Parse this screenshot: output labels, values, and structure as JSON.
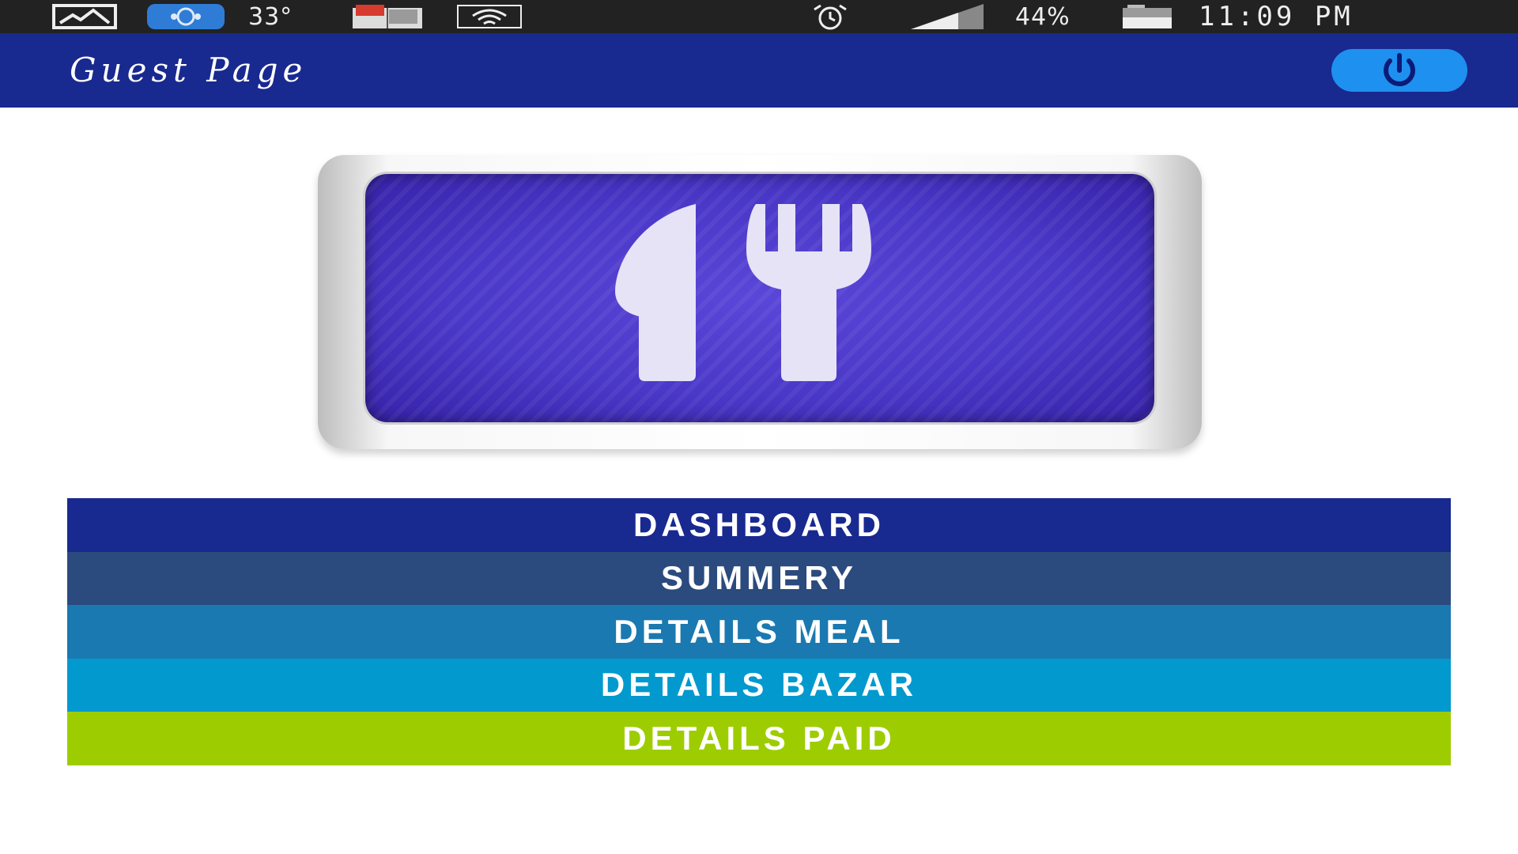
{
  "status_bar": {
    "temperature": "33°",
    "battery": "44%",
    "time": "11:09 PM",
    "icons": [
      "gallery-icon",
      "shareit-icon",
      "weather-icon",
      "book-icon",
      "wifi-icon",
      "alarm-icon",
      "signal-icon",
      "battery-icon"
    ]
  },
  "app_bar": {
    "title": "Guest Page",
    "action_icon": "power-icon",
    "color": "#18298f",
    "action_color": "#1e90ef"
  },
  "hero": {
    "icon": "knife-fork-icon",
    "color": "#4a38c8"
  },
  "menu": {
    "items": [
      {
        "label": "DASHBOARD",
        "color": "#18298f"
      },
      {
        "label": "SUMMERY",
        "color": "#2b4a7e"
      },
      {
        "label": "DETAILS MEAL",
        "color": "#1a79b0"
      },
      {
        "label": "DETAILS BAZAR",
        "color": "#0199ce"
      },
      {
        "label": "DETAILS PAID",
        "color": "#9dcd00"
      }
    ]
  }
}
